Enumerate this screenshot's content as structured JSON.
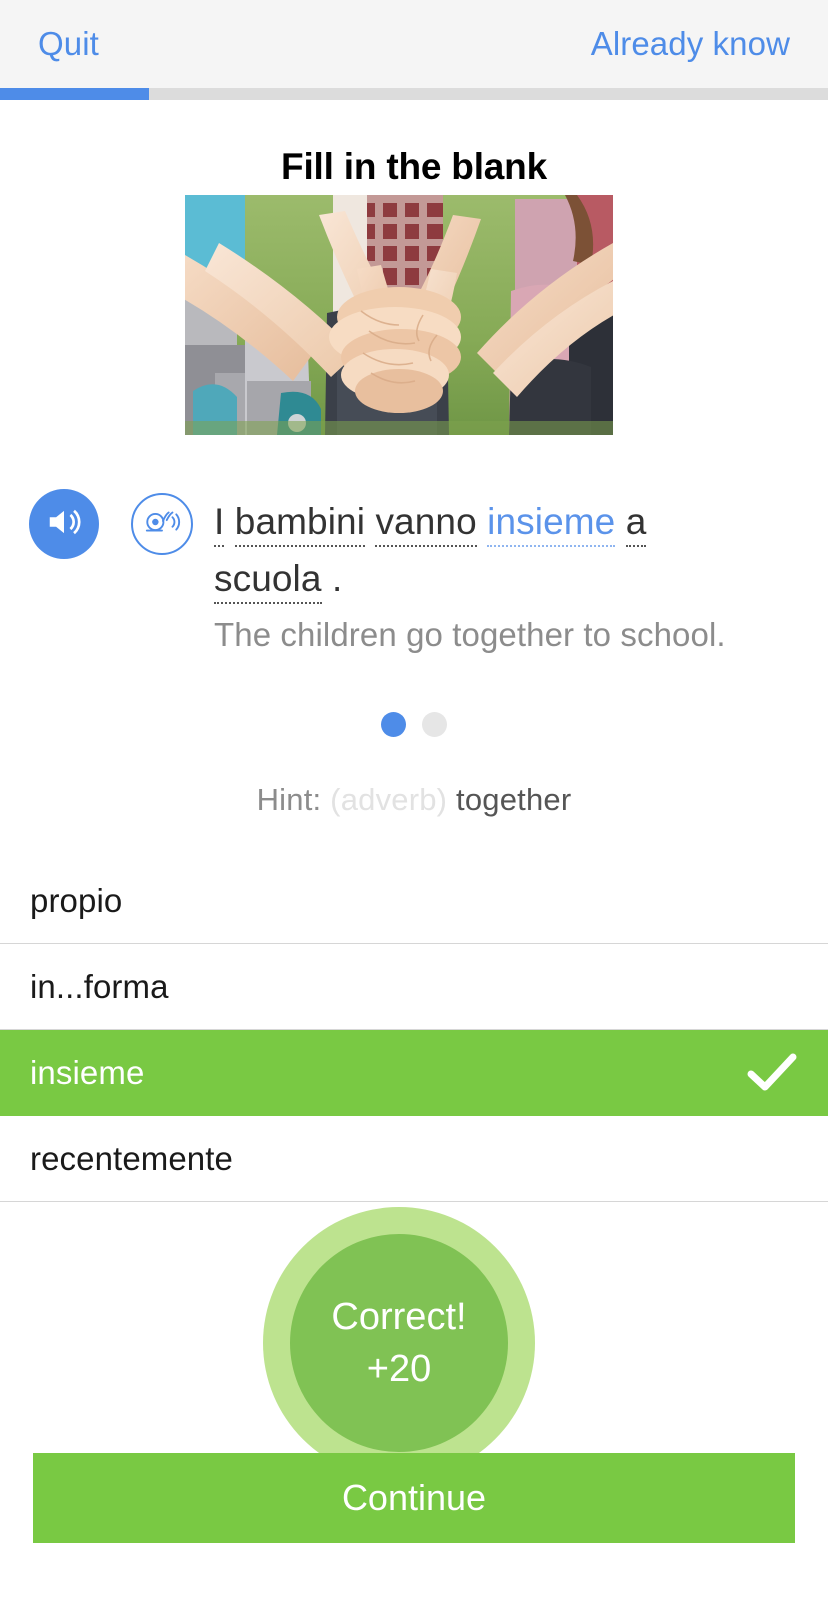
{
  "header": {
    "quit_label": "Quit",
    "already_know_label": "Already know",
    "progress_percent": 18
  },
  "exercise": {
    "title": "Fill in the blank",
    "image_alt": "group of people stacking hands together outdoors",
    "audio_normal_icon": "speaker-icon",
    "audio_slow_icon": "snail-speaker-icon",
    "sentence_tokens": [
      {
        "text": "I",
        "style": "dotted"
      },
      {
        "text": "bambini",
        "style": "dotted"
      },
      {
        "text": "vanno",
        "style": "dotted"
      },
      {
        "text": "insieme",
        "style": "answer"
      },
      {
        "text": "a",
        "style": "dotted"
      },
      {
        "text": "scuola",
        "style": "dotted"
      },
      {
        "text": ".",
        "style": "plain"
      }
    ],
    "translation": "The children go together to school.",
    "pager": {
      "count": 2,
      "active_index": 0
    },
    "hint_label": "Hint:",
    "hint_pos": "(adverb)",
    "hint_word": "together"
  },
  "options": [
    {
      "label": "propio",
      "correct": false
    },
    {
      "label": "in...forma",
      "correct": false
    },
    {
      "label": "insieme",
      "correct": true,
      "icon": "check-icon"
    },
    {
      "label": "recentemente",
      "correct": false
    }
  ],
  "feedback": {
    "result_text": "Correct!",
    "points_text": "+20"
  },
  "footer": {
    "continue_label": "Continue"
  },
  "colors": {
    "accent_blue": "#4e8ce8",
    "correct_green": "#79c943",
    "badge_outer_green": "#bde38f",
    "badge_inner_green": "#80c254",
    "header_bg": "#f5f5f5",
    "muted_text": "#8c8c8c"
  }
}
